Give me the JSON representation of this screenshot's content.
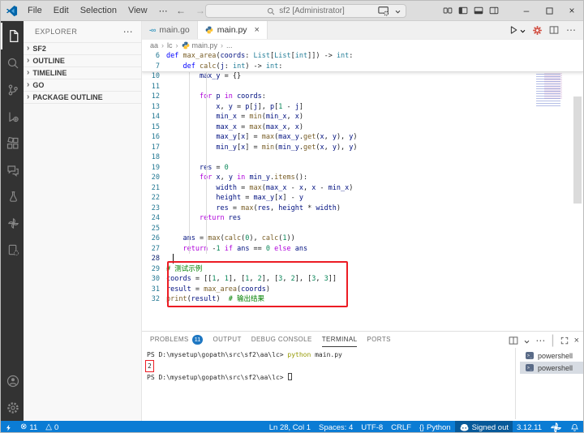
{
  "title_bar": {
    "menus": [
      "File",
      "Edit",
      "Selection",
      "View"
    ],
    "menu_more": "⋯",
    "nav_back": "←",
    "nav_forward": "→",
    "search_value": "sf2 [Administrator]"
  },
  "activity_bar": {
    "top": [
      {
        "icon": "explorer-icon",
        "active": true
      },
      {
        "icon": "search-icon"
      },
      {
        "icon": "source-control-icon"
      },
      {
        "icon": "run-debug-icon"
      },
      {
        "icon": "extensions-icon"
      },
      {
        "icon": "chat-icon"
      },
      {
        "icon": "testing-icon"
      },
      {
        "icon": "pinwheel-icon"
      },
      {
        "icon": "file-gear-icon"
      }
    ],
    "bottom": [
      {
        "icon": "account-icon"
      },
      {
        "icon": "settings-gear-icon"
      }
    ]
  },
  "sidebar": {
    "title": "EXPLORER",
    "more": "⋯",
    "chevron": "›",
    "sections": [
      "SF2",
      "OUTLINE",
      "TIMELINE",
      "GO",
      "PACKAGE OUTLINE"
    ]
  },
  "editor": {
    "tabs": [
      {
        "label": "main.go",
        "icon": "go-file-icon",
        "active": false
      },
      {
        "label": "main.py",
        "icon": "python-file-icon",
        "active": true,
        "close": "×"
      }
    ],
    "breadcrumb": [
      {
        "label": "aa"
      },
      {
        "label": "lc"
      },
      {
        "label": "main.py",
        "icon": "python-file-icon"
      },
      {
        "label": "..."
      }
    ],
    "sticky_lines": [
      {
        "num": "6",
        "segs": [
          [
            "kw",
            "def"
          ],
          [
            "pln",
            " "
          ],
          [
            "fn",
            "max_area"
          ],
          [
            "pln",
            "("
          ],
          [
            "var",
            "coords"
          ],
          [
            "pln",
            ": "
          ],
          [
            "typ",
            "List"
          ],
          [
            "pln",
            "["
          ],
          [
            "typ",
            "List"
          ],
          [
            "pln",
            "["
          ],
          [
            "typ",
            "int"
          ],
          [
            "pln",
            "]]) -> "
          ],
          [
            "typ",
            "int"
          ],
          [
            "pln",
            ":"
          ]
        ]
      },
      {
        "num": "7",
        "segs": [
          [
            "pln",
            "    "
          ],
          [
            "kw",
            "def"
          ],
          [
            "pln",
            " "
          ],
          [
            "fn",
            "calc"
          ],
          [
            "pln",
            "("
          ],
          [
            "var",
            "j"
          ],
          [
            "pln",
            ": "
          ],
          [
            "typ",
            "int"
          ],
          [
            "pln",
            ") -> "
          ],
          [
            "typ",
            "int"
          ],
          [
            "pln",
            ":"
          ]
        ]
      }
    ],
    "lines": [
      {
        "num": "10",
        "segs": [
          [
            "pln",
            "        "
          ],
          [
            "var",
            "max_y"
          ],
          [
            "pln",
            " = {}"
          ]
        ]
      },
      {
        "num": "11",
        "segs": []
      },
      {
        "num": "12",
        "segs": [
          [
            "pln",
            "        "
          ],
          [
            "ctl",
            "for"
          ],
          [
            "pln",
            " "
          ],
          [
            "var",
            "p"
          ],
          [
            "pln",
            " "
          ],
          [
            "ctl",
            "in"
          ],
          [
            "pln",
            " "
          ],
          [
            "var",
            "coords"
          ],
          [
            "pln",
            ":"
          ]
        ]
      },
      {
        "num": "13",
        "segs": [
          [
            "pln",
            "            "
          ],
          [
            "var",
            "x"
          ],
          [
            "pln",
            ", "
          ],
          [
            "var",
            "y"
          ],
          [
            "pln",
            " = "
          ],
          [
            "var",
            "p"
          ],
          [
            "pln",
            "["
          ],
          [
            "var",
            "j"
          ],
          [
            "pln",
            "], "
          ],
          [
            "var",
            "p"
          ],
          [
            "pln",
            "["
          ],
          [
            "num",
            "1"
          ],
          [
            "pln",
            " - "
          ],
          [
            "var",
            "j"
          ],
          [
            "pln",
            "]"
          ]
        ]
      },
      {
        "num": "14",
        "segs": [
          [
            "pln",
            "            "
          ],
          [
            "var",
            "min_x"
          ],
          [
            "pln",
            " = "
          ],
          [
            "fn",
            "min"
          ],
          [
            "pln",
            "("
          ],
          [
            "var",
            "min_x"
          ],
          [
            "pln",
            ", "
          ],
          [
            "var",
            "x"
          ],
          [
            "pln",
            ")"
          ]
        ]
      },
      {
        "num": "15",
        "segs": [
          [
            "pln",
            "            "
          ],
          [
            "var",
            "max_x"
          ],
          [
            "pln",
            " = "
          ],
          [
            "fn",
            "max"
          ],
          [
            "pln",
            "("
          ],
          [
            "var",
            "max_x"
          ],
          [
            "pln",
            ", "
          ],
          [
            "var",
            "x"
          ],
          [
            "pln",
            ")"
          ]
        ]
      },
      {
        "num": "16",
        "segs": [
          [
            "pln",
            "            "
          ],
          [
            "var",
            "max_y"
          ],
          [
            "pln",
            "["
          ],
          [
            "var",
            "x"
          ],
          [
            "pln",
            "] = "
          ],
          [
            "fn",
            "max"
          ],
          [
            "pln",
            "("
          ],
          [
            "var",
            "max_y"
          ],
          [
            "pln",
            "."
          ],
          [
            "fn",
            "get"
          ],
          [
            "pln",
            "("
          ],
          [
            "var",
            "x"
          ],
          [
            "pln",
            ", "
          ],
          [
            "var",
            "y"
          ],
          [
            "pln",
            "), "
          ],
          [
            "var",
            "y"
          ],
          [
            "pln",
            ")"
          ]
        ]
      },
      {
        "num": "17",
        "segs": [
          [
            "pln",
            "            "
          ],
          [
            "var",
            "min_y"
          ],
          [
            "pln",
            "["
          ],
          [
            "var",
            "x"
          ],
          [
            "pln",
            "] = "
          ],
          [
            "fn",
            "min"
          ],
          [
            "pln",
            "("
          ],
          [
            "var",
            "min_y"
          ],
          [
            "pln",
            "."
          ],
          [
            "fn",
            "get"
          ],
          [
            "pln",
            "("
          ],
          [
            "var",
            "x"
          ],
          [
            "pln",
            ", "
          ],
          [
            "var",
            "y"
          ],
          [
            "pln",
            "), "
          ],
          [
            "var",
            "y"
          ],
          [
            "pln",
            ")"
          ]
        ]
      },
      {
        "num": "18",
        "segs": []
      },
      {
        "num": "19",
        "segs": [
          [
            "pln",
            "        "
          ],
          [
            "var",
            "res"
          ],
          [
            "pln",
            " = "
          ],
          [
            "num",
            "0"
          ]
        ]
      },
      {
        "num": "20",
        "segs": [
          [
            "pln",
            "        "
          ],
          [
            "ctl",
            "for"
          ],
          [
            "pln",
            " "
          ],
          [
            "var",
            "x"
          ],
          [
            "pln",
            ", "
          ],
          [
            "var",
            "y"
          ],
          [
            "pln",
            " "
          ],
          [
            "ctl",
            "in"
          ],
          [
            "pln",
            " "
          ],
          [
            "var",
            "min_y"
          ],
          [
            "pln",
            "."
          ],
          [
            "fn",
            "items"
          ],
          [
            "pln",
            "():"
          ]
        ]
      },
      {
        "num": "21",
        "segs": [
          [
            "pln",
            "            "
          ],
          [
            "var",
            "width"
          ],
          [
            "pln",
            " = "
          ],
          [
            "fn",
            "max"
          ],
          [
            "pln",
            "("
          ],
          [
            "var",
            "max_x"
          ],
          [
            "pln",
            " - "
          ],
          [
            "var",
            "x"
          ],
          [
            "pln",
            ", "
          ],
          [
            "var",
            "x"
          ],
          [
            "pln",
            " - "
          ],
          [
            "var",
            "min_x"
          ],
          [
            "pln",
            ")"
          ]
        ]
      },
      {
        "num": "22",
        "segs": [
          [
            "pln",
            "            "
          ],
          [
            "var",
            "height"
          ],
          [
            "pln",
            " = "
          ],
          [
            "var",
            "max_y"
          ],
          [
            "pln",
            "["
          ],
          [
            "var",
            "x"
          ],
          [
            "pln",
            "] - "
          ],
          [
            "var",
            "y"
          ]
        ]
      },
      {
        "num": "23",
        "segs": [
          [
            "pln",
            "            "
          ],
          [
            "var",
            "res"
          ],
          [
            "pln",
            " = "
          ],
          [
            "fn",
            "max"
          ],
          [
            "pln",
            "("
          ],
          [
            "var",
            "res"
          ],
          [
            "pln",
            ", "
          ],
          [
            "var",
            "height"
          ],
          [
            "pln",
            " * "
          ],
          [
            "var",
            "width"
          ],
          [
            "pln",
            ")"
          ]
        ]
      },
      {
        "num": "24",
        "segs": [
          [
            "pln",
            "        "
          ],
          [
            "ctl",
            "return"
          ],
          [
            "pln",
            " "
          ],
          [
            "var",
            "res"
          ]
        ]
      },
      {
        "num": "25",
        "segs": []
      },
      {
        "num": "26",
        "segs": [
          [
            "pln",
            "    "
          ],
          [
            "var",
            "ans"
          ],
          [
            "pln",
            " = "
          ],
          [
            "fn",
            "max"
          ],
          [
            "pln",
            "("
          ],
          [
            "fn",
            "calc"
          ],
          [
            "pln",
            "("
          ],
          [
            "num",
            "0"
          ],
          [
            "pln",
            "), "
          ],
          [
            "fn",
            "calc"
          ],
          [
            "pln",
            "("
          ],
          [
            "num",
            "1"
          ],
          [
            "pln",
            "))"
          ]
        ]
      },
      {
        "num": "27",
        "segs": [
          [
            "pln",
            "    "
          ],
          [
            "ctl",
            "return"
          ],
          [
            "pln",
            " -"
          ],
          [
            "num",
            "1"
          ],
          [
            "pln",
            " "
          ],
          [
            "ctl",
            "if"
          ],
          [
            "pln",
            " "
          ],
          [
            "var",
            "ans"
          ],
          [
            "pln",
            " == "
          ],
          [
            "num",
            "0"
          ],
          [
            "pln",
            " "
          ],
          [
            "ctl",
            "else"
          ],
          [
            "pln",
            " "
          ],
          [
            "var",
            "ans"
          ]
        ]
      },
      {
        "num": "28",
        "segs": [],
        "current": true
      },
      {
        "num": "29",
        "segs": [
          [
            "com",
            "# 测试示例"
          ]
        ]
      },
      {
        "num": "30",
        "segs": [
          [
            "var",
            "coords"
          ],
          [
            "pln",
            " = [["
          ],
          [
            "num",
            "1"
          ],
          [
            "pln",
            ", "
          ],
          [
            "num",
            "1"
          ],
          [
            "pln",
            "], ["
          ],
          [
            "num",
            "1"
          ],
          [
            "pln",
            ", "
          ],
          [
            "num",
            "2"
          ],
          [
            "pln",
            "], ["
          ],
          [
            "num",
            "3"
          ],
          [
            "pln",
            ", "
          ],
          [
            "num",
            "2"
          ],
          [
            "pln",
            "], ["
          ],
          [
            "num",
            "3"
          ],
          [
            "pln",
            ", "
          ],
          [
            "num",
            "3"
          ],
          [
            "pln",
            "]]"
          ]
        ]
      },
      {
        "num": "31",
        "segs": [
          [
            "var",
            "result"
          ],
          [
            "pln",
            " = "
          ],
          [
            "fn",
            "max_area"
          ],
          [
            "pln",
            "("
          ],
          [
            "var",
            "coords"
          ],
          [
            "pln",
            ")"
          ]
        ]
      },
      {
        "num": "32",
        "segs": [
          [
            "fn",
            "print"
          ],
          [
            "pln",
            "("
          ],
          [
            "var",
            "result"
          ],
          [
            "pln",
            ")  "
          ],
          [
            "com",
            "# 输出结果"
          ]
        ]
      }
    ]
  },
  "panel": {
    "tabs": [
      {
        "label": "PROBLEMS",
        "badge": "11"
      },
      {
        "label": "OUTPUT"
      },
      {
        "label": "DEBUG CONSOLE"
      },
      {
        "label": "TERMINAL",
        "active": true
      },
      {
        "label": "PORTS"
      }
    ],
    "terminal_rows": [
      {
        "segs": [
          [
            "tp",
            "PS D:\\mysetup\\gopath\\src\\sf2\\aa\\lc> "
          ],
          [
            "tc",
            "python"
          ],
          [
            "tp",
            " main.py"
          ]
        ]
      },
      {
        "segs": [
          [
            "tp",
            "2"
          ]
        ],
        "boxed": true
      },
      {
        "segs": [
          [
            "tp",
            "PS D:\\mysetup\\gopath\\src\\sf2\\aa\\lc> "
          ]
        ],
        "cursor": true
      }
    ],
    "terminal_list": [
      {
        "label": "powershell"
      },
      {
        "label": "powershell",
        "selected": true
      }
    ]
  },
  "status_bar": {
    "left": [
      {
        "name": "remote-indicator",
        "icon": "bolt-icon"
      },
      {
        "name": "errors-count",
        "icon": "error-icon",
        "label": "11"
      },
      {
        "name": "warnings-count",
        "icon": "warning-icon",
        "label": "0"
      }
    ],
    "right": [
      {
        "name": "cursor-position",
        "label": "Ln 28, Col 1"
      },
      {
        "name": "indentation",
        "label": "Spaces: 4"
      },
      {
        "name": "encoding",
        "label": "UTF-8"
      },
      {
        "name": "eol-sequence",
        "label": "CRLF"
      },
      {
        "name": "language-mode",
        "icon": "braces-icon",
        "label": "Python"
      },
      {
        "name": "copilot-status",
        "icon": "copilot-icon",
        "label": "Signed out",
        "dark": true
      },
      {
        "name": "python-version",
        "label": "3.12.11"
      },
      {
        "name": "extension-status",
        "icon": "pinwheel-icon"
      },
      {
        "name": "notifications-bell",
        "icon": "bell-icon"
      }
    ]
  },
  "colors": {
    "accent": "#0b7cd4",
    "annotation_red": "#ec1c24",
    "badge_blue": "#1e77c2"
  }
}
